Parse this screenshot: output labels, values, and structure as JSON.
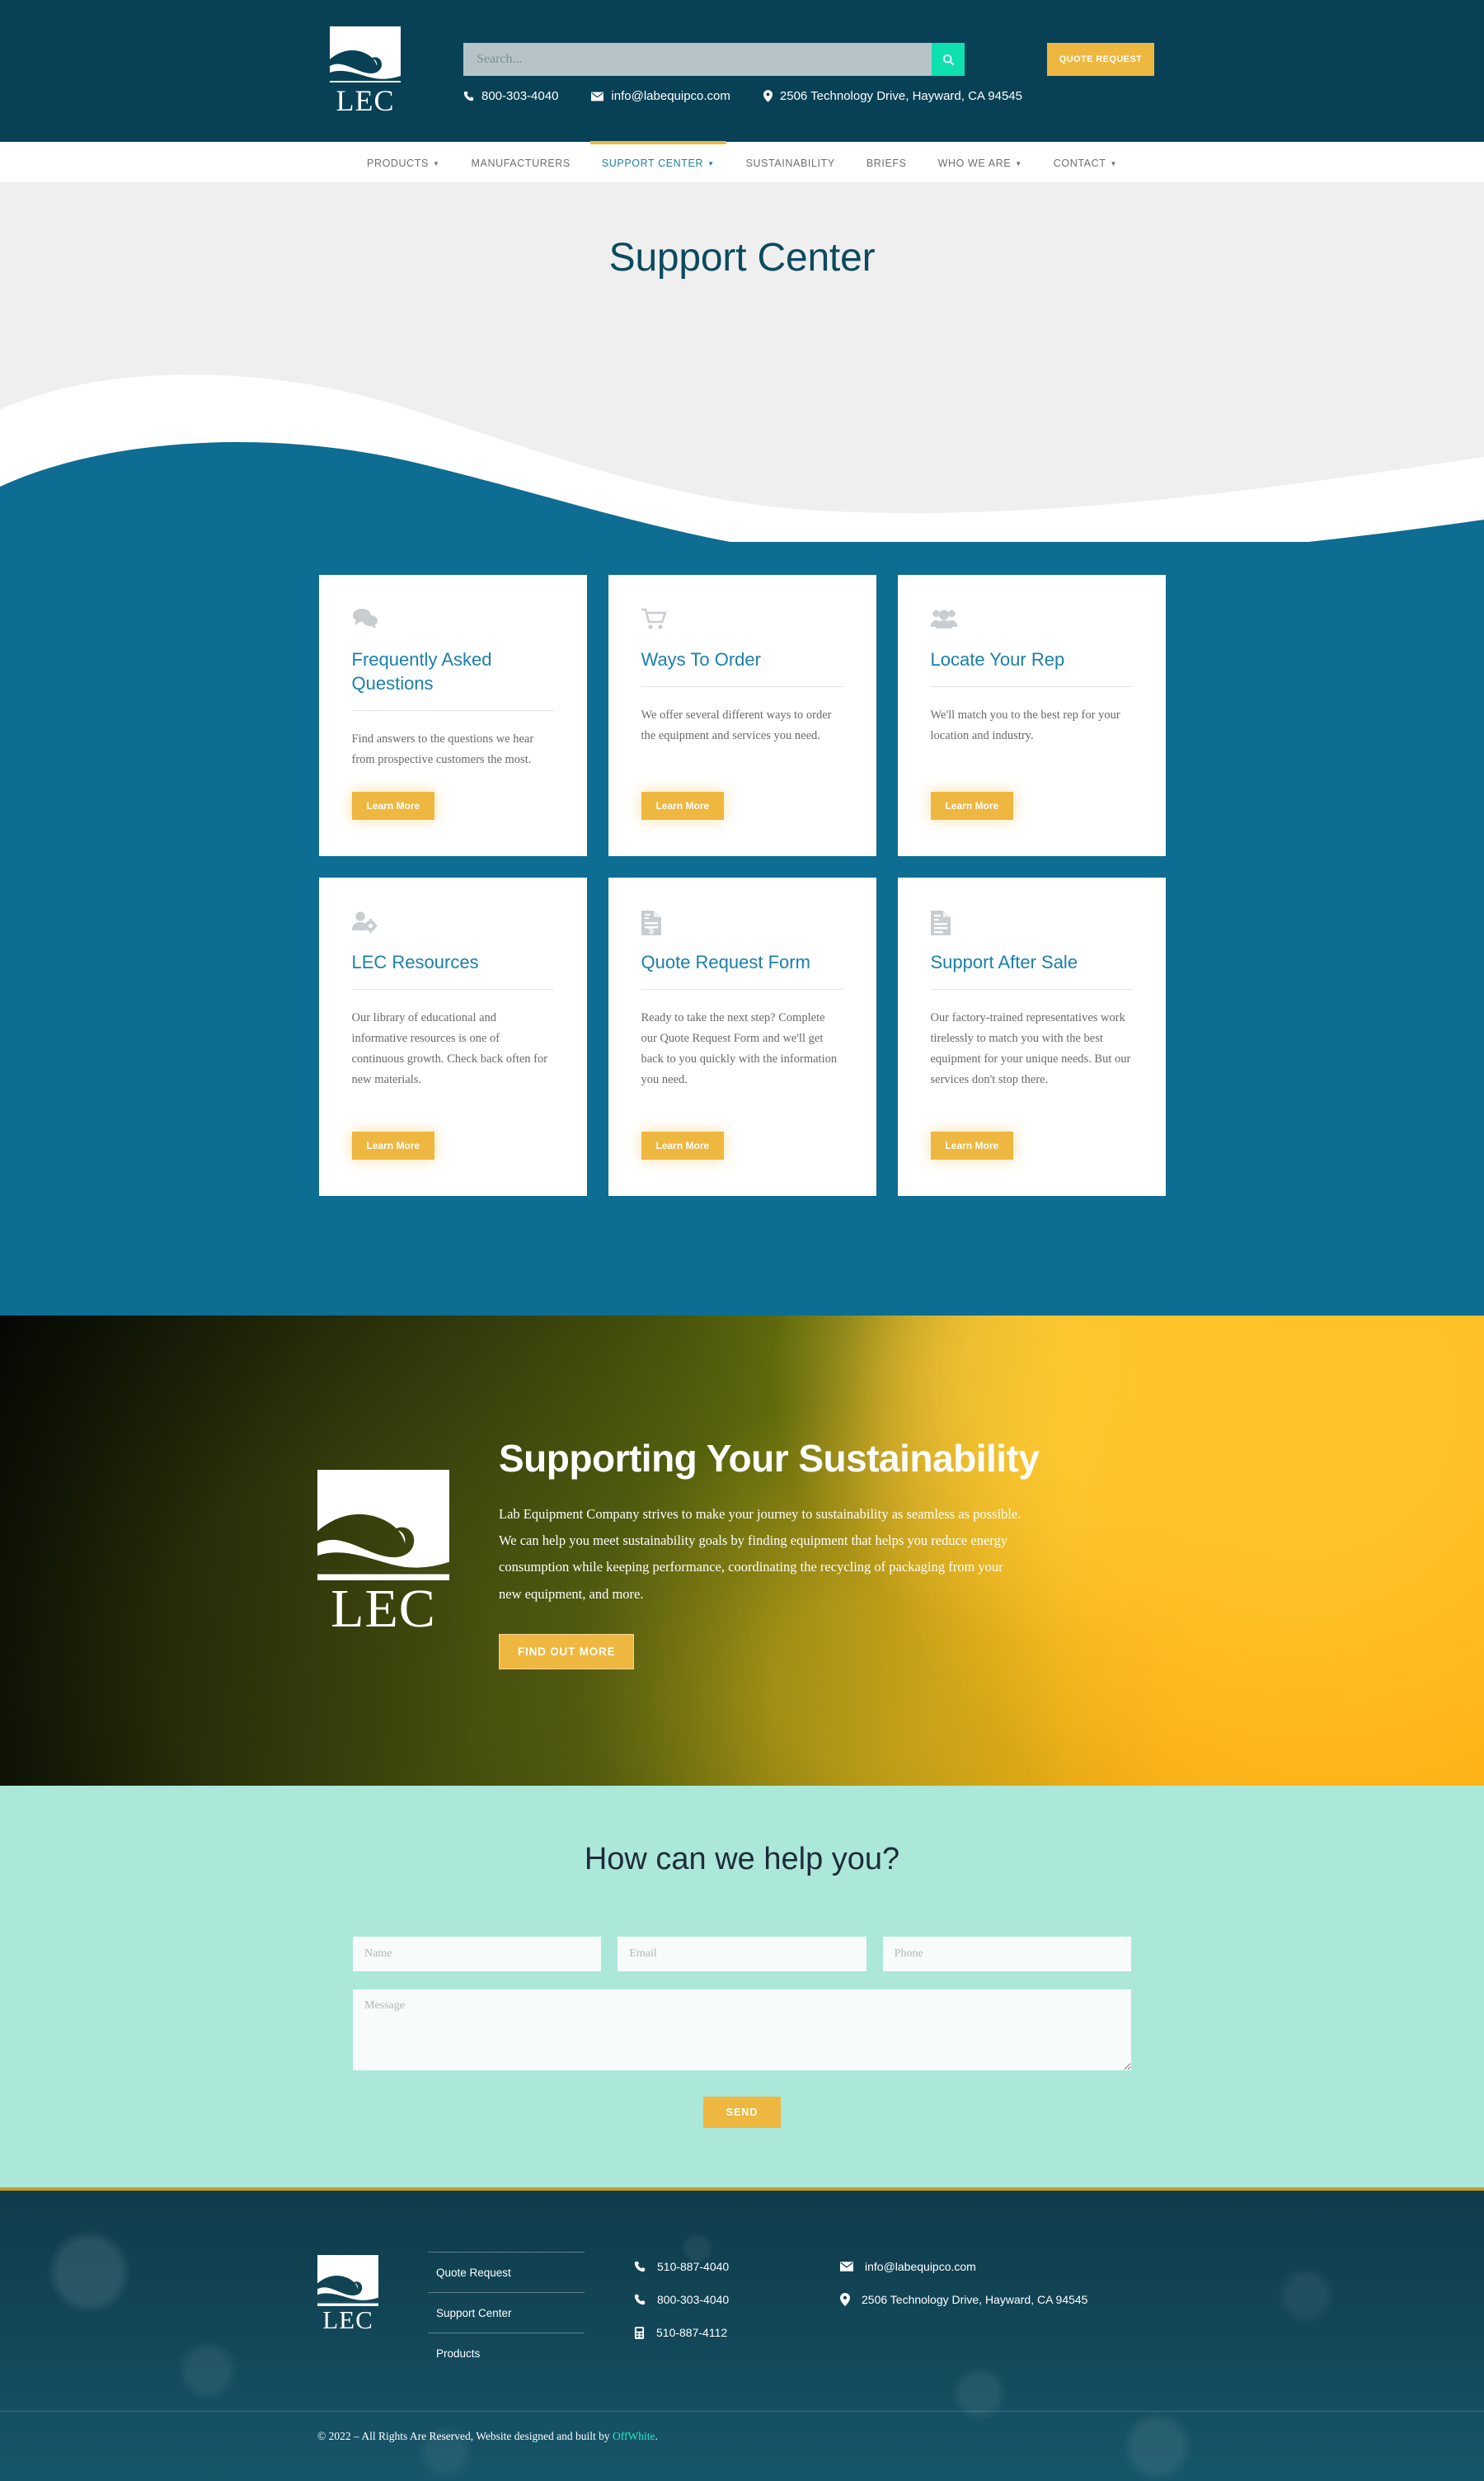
{
  "header": {
    "logo_word": "LEC",
    "search": {
      "placeholder": "Search...",
      "value": ""
    },
    "quote_button": "QUOTE REQUEST",
    "contacts": [
      {
        "icon": "phone-icon",
        "text": "800-303-4040"
      },
      {
        "icon": "envelope-icon",
        "text": "info@labequipco.com"
      },
      {
        "icon": "map-pin-icon",
        "text": "2506 Technology Drive, Hayward, CA 94545"
      }
    ]
  },
  "nav": {
    "items": [
      {
        "label": "PRODUCTS",
        "caret": true,
        "active": false
      },
      {
        "label": "MANUFACTURERS",
        "caret": false,
        "active": false
      },
      {
        "label": "SUPPORT CENTER",
        "caret": true,
        "active": true
      },
      {
        "label": "SUSTAINABILITY",
        "caret": false,
        "active": false
      },
      {
        "label": "BRIEFS",
        "caret": false,
        "active": false
      },
      {
        "label": "WHO WE ARE",
        "caret": true,
        "active": false
      },
      {
        "label": "CONTACT",
        "caret": true,
        "active": false
      }
    ]
  },
  "hero": {
    "title": "Support Center"
  },
  "cards": [
    {
      "icon": "speech-bubbles-icon",
      "title": "Frequently Asked Questions",
      "body": "Find answers to the questions we hear from prospective customers the most.",
      "button": "Learn More"
    },
    {
      "icon": "shopping-cart-icon",
      "title": "Ways To Order",
      "body": "We offer several different ways to order the equipment and services you need.",
      "button": "Learn More"
    },
    {
      "icon": "people-group-icon",
      "title": "Locate Your Rep",
      "body": "We'll match you to the best rep for your location and industry.",
      "button": "Learn More"
    },
    {
      "icon": "user-gear-icon",
      "title": "LEC Resources",
      "body": "Our library of educational and informative resources is one of continuous growth. Check back often for new materials.",
      "button": "Learn More"
    },
    {
      "icon": "invoice-dollar-icon",
      "title": "Quote Request Form",
      "body": "Ready to take the next step? Complete our Quote Request Form and we'll get back to you quickly with the information you need.",
      "button": "Learn More"
    },
    {
      "icon": "document-lines-icon",
      "title": "Support After Sale",
      "body": "Our factory-trained representatives work tirelessly to match you with the best equipment for your unique needs. But our services don't stop there.",
      "button": "Learn More"
    }
  ],
  "sustainability": {
    "logo_word": "LEC",
    "heading": "Supporting Your Sustainability",
    "body": "Lab Equipment Company strives to make your journey to sustainability as seamless as possible. We can help you meet sustainability goals by finding equipment that helps you reduce energy consumption while keeping performance,  coordinating the recycling of packaging from your new equipment, and more.",
    "button": "FIND OUT MORE"
  },
  "contact_form": {
    "heading": "How can we help you?",
    "name_placeholder": "Name",
    "email_placeholder": "Email",
    "phone_placeholder": "Phone",
    "message_placeholder": "Message",
    "send_button": "SEND",
    "name_value": "",
    "email_value": "",
    "phone_value": "",
    "message_value": ""
  },
  "footer": {
    "logo_word": "LEC",
    "links": [
      "Quote Request",
      "Support Center",
      "Products"
    ],
    "contacts_col1": [
      {
        "icon": "phone-icon",
        "text": "510-887-4040"
      },
      {
        "icon": "phone-icon",
        "text": "800-303-4040"
      },
      {
        "icon": "fax-icon",
        "text": "510-887-4112"
      }
    ],
    "contacts_col2": [
      {
        "icon": "envelope-icon",
        "text": "info@labequipco.com"
      },
      {
        "icon": "map-pin-icon",
        "text": "2506 Technology Drive, Hayward, CA 94545"
      }
    ],
    "copyright_prefix": "© 2022 – All Rights Are Reserved, Website designed and built by ",
    "copyright_link": "OffWhite",
    "copyright_suffix": "."
  },
  "colors": {
    "header_teal": "#084155",
    "card_section_blue": "#0d6d92",
    "accent_gold": "#eeb73f",
    "link_blue": "#1a7fab",
    "mint": "#abe8d9",
    "search_button_green": "#0ee0b0",
    "footer_link_green": "#2ee8c0"
  }
}
